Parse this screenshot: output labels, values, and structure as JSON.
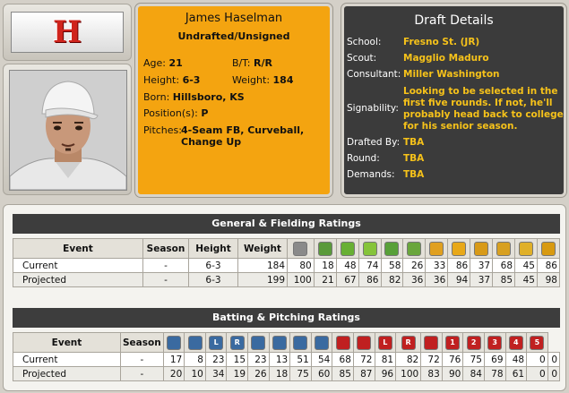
{
  "logo": {
    "letter": "H",
    "color": "#d0241c"
  },
  "player": {
    "name": "James Haselman",
    "status": "Undrafted/Unsigned",
    "age_label": "Age:",
    "age": "21",
    "bt_label": "B/T:",
    "bt": "R/R",
    "height_label": "Height:",
    "height": "6-3",
    "weight_label": "Weight:",
    "weight": "184",
    "born_label": "Born:",
    "born": "Hillsboro, KS",
    "positions_label": "Position(s):",
    "positions": "P",
    "pitches_label": "Pitches:",
    "pitches_line1": "4-Seam FB, Curveball,",
    "pitches_line2": "Change Up"
  },
  "draft": {
    "title": "Draft Details",
    "school_label": "School:",
    "school": "Fresno St. (JR)",
    "scout_label": "Scout:",
    "scout": "Magglio Maduro",
    "consultant_label": "Consultant:",
    "consultant": "Miller Washington",
    "signability_label": "Signability:",
    "signability_l1": "Looking to be selected in the",
    "signability_l2": "first five rounds. If not, he'll",
    "signability_l3": "probably head back to college",
    "signability_l4": "for his senior season.",
    "drafted_by_label": "Drafted By:",
    "drafted_by": "TBA",
    "round_label": "Round:",
    "round": "TBA",
    "demands_label": "Demands:",
    "demands": "TBA"
  },
  "fielding": {
    "title": "General & Fielding Ratings",
    "headers": {
      "event": "Event",
      "season": "Season",
      "height": "Height",
      "weight": "Weight"
    },
    "icons": [
      "fielding-x-icon",
      "plane-icon",
      "eye-icon",
      "cap-icon",
      "target-icon",
      "shield-icon",
      "glove-icon",
      "plus-icon",
      "bars-icon",
      "ball-icon",
      "medal-icon",
      "letter-e-icon"
    ],
    "icon_colors": [
      "#8a8a8a",
      "#5a9a3a",
      "#68b034",
      "#86c43a",
      "#58a038",
      "#6aa63c",
      "#e0a020",
      "#e8a818",
      "#d89a18",
      "#d8a020",
      "#e0b028",
      "#d89a10"
    ],
    "rows": [
      {
        "event": "Current",
        "season": "-",
        "height": "6-3",
        "weight": "184",
        "vals": [
          "80",
          "18",
          "48",
          "74",
          "58",
          "26",
          "33",
          "86",
          "37",
          "68",
          "45",
          "86"
        ]
      },
      {
        "event": "Projected",
        "season": "-",
        "height": "6-3",
        "weight": "199",
        "vals": [
          "100",
          "21",
          "67",
          "86",
          "82",
          "36",
          "36",
          "94",
          "37",
          "85",
          "45",
          "98"
        ]
      }
    ]
  },
  "batting": {
    "title": "Batting & Pitching Ratings",
    "headers": {
      "event": "Event",
      "season": "Season"
    },
    "icons": [
      "contact-icon",
      "power-icon",
      "vs-left-icon",
      "vs-right-icon",
      "eye-icon",
      "gap-icon",
      "camera-icon",
      "arrow-down-icon",
      "stuff-icon",
      "movement-icon",
      "left-icon",
      "right-icon",
      "velocity-icon",
      "pitch1-icon",
      "pitch2-icon",
      "pitch3-icon",
      "pitch4-icon",
      "pitch5-icon"
    ],
    "icon_labels": [
      "",
      "",
      "L",
      "R",
      "",
      "",
      "",
      "",
      "",
      "",
      "L",
      "R",
      "",
      "1",
      "2",
      "3",
      "4",
      "5"
    ],
    "icon_colors": [
      "#3a6aa0",
      "#3a6aa0",
      "#3a6aa0",
      "#3a6aa0",
      "#3a6aa0",
      "#3a6aa0",
      "#3a6aa0",
      "#3a6aa0",
      "#c02020",
      "#c02020",
      "#c02020",
      "#c02020",
      "#c02020",
      "#c02020",
      "#c02020",
      "#c02020",
      "#c02020",
      "#c02020"
    ],
    "rows": [
      {
        "event": "Current",
        "season": "-",
        "vals": [
          "17",
          "8",
          "23",
          "15",
          "23",
          "13",
          "51",
          "54",
          "68",
          "72",
          "81",
          "82",
          "72",
          "76",
          "75",
          "69",
          "48",
          "0",
          "0"
        ]
      },
      {
        "event": "Projected",
        "season": "-",
        "vals": [
          "20",
          "10",
          "34",
          "19",
          "26",
          "18",
          "75",
          "60",
          "85",
          "87",
          "96",
          "100",
          "83",
          "90",
          "84",
          "78",
          "61",
          "0",
          "0"
        ]
      }
    ]
  }
}
